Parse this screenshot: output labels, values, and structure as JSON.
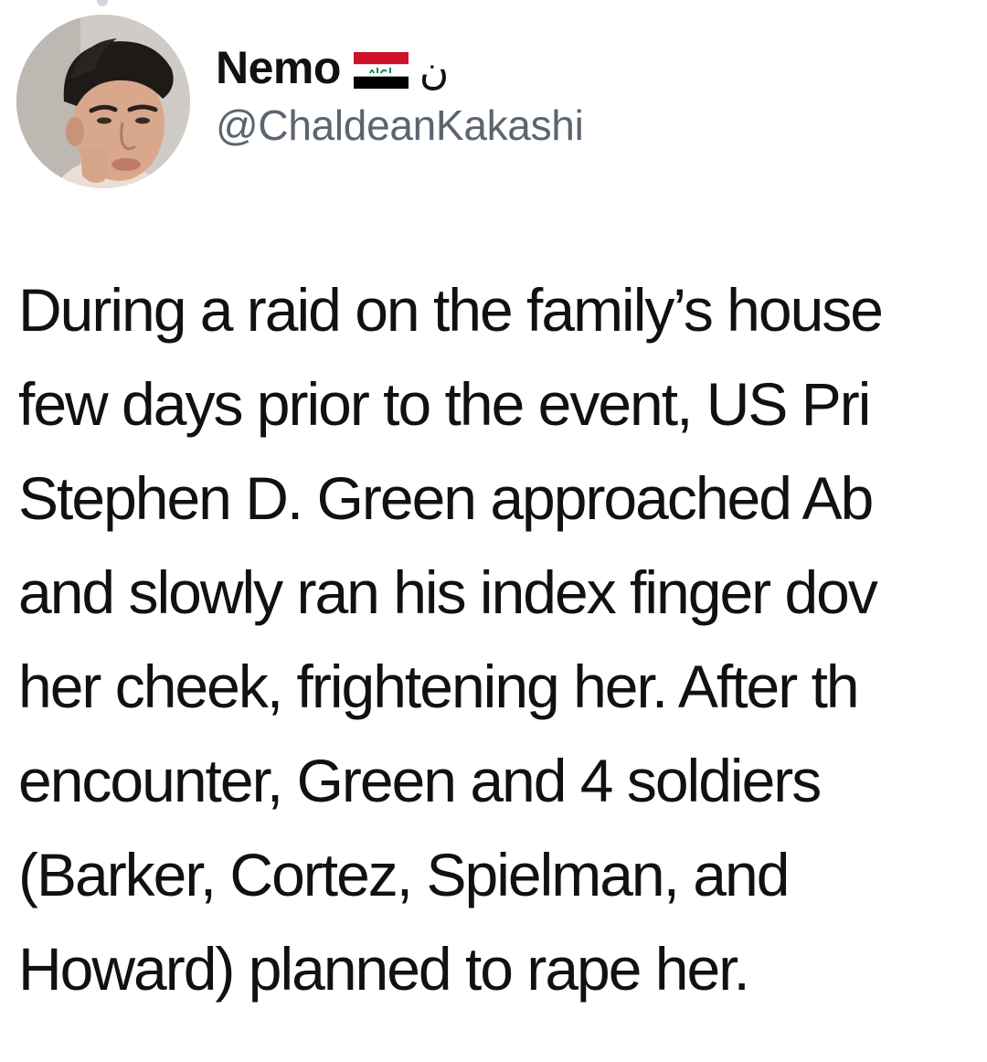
{
  "tweet": {
    "author": {
      "display_name": "Nemo",
      "flag_icon": "iraq-flag-icon",
      "arabic_letter": "ن",
      "handle": "@ChaldeanKakashi",
      "avatar_icon": "profile-photo"
    },
    "text_lines": [
      "During a raid on the family’s house",
      "few days prior to the event, US Pri",
      "Stephen D. Green approached Ab",
      "and slowly ran his index finger dov",
      "her cheek, frightening her. After th",
      "encounter, Green and 4 soldiers",
      "(Barker, Cortez, Spielman, and",
      "Howard) planned to rape her."
    ]
  },
  "colors": {
    "text": "#111111",
    "handle": "#5b6570",
    "background": "#ffffff",
    "flag_red": "#ce1126",
    "flag_white": "#ffffff",
    "flag_black": "#000000",
    "flag_green": "#007a3d"
  }
}
